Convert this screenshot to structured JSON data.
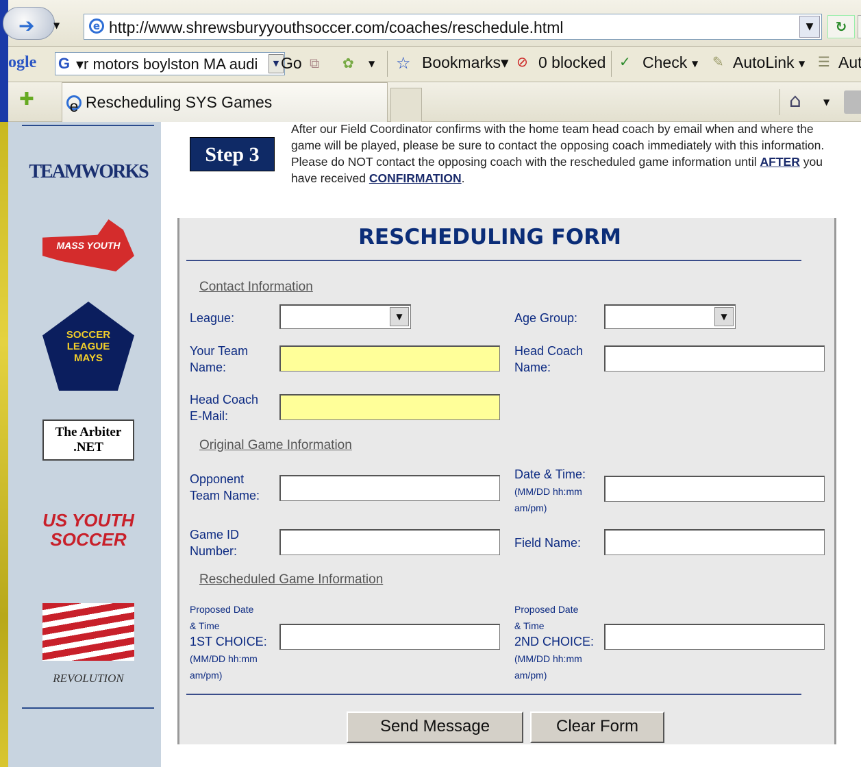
{
  "browser": {
    "address_url": "http://www.shrewsburyyouthsoccer.com/coaches/reschedule.html",
    "google_label": "ogle",
    "search_text": "▾r motors boylston MA audi",
    "go_label": "Go",
    "bookmarks_label": "Bookmarks▾",
    "blocked_label": "0 blocked",
    "check_label": "Check",
    "autolink_label": "AutoLink",
    "autofill_label": "Aut",
    "tab_title": "Rescheduling SYS Games"
  },
  "sidebar": {
    "logos": [
      "TEAMWORKS",
      "MASS YOUTH",
      "SOCCER LEAGUE MAYS",
      "The Arbiter .NET",
      "US YOUTH SOCCER",
      "REVOLUTION"
    ]
  },
  "step": {
    "label": "Step 3",
    "text_1": "After our Field Coordinator confirms with the home team head coach by email when and where the game will be played, please be sure to contact the opposing coach immediately with this information. Please do NOT contact the opposing coach with the rescheduled game information until ",
    "after": "AFTER",
    "text_2": " you have received ",
    "confirmation": "CONFIRMATION",
    "text_3": "."
  },
  "form": {
    "title": "RESCHEDULING FORM",
    "contact_section": "Contact Information",
    "league_label": "League:",
    "age_group_label": "Age Group:",
    "team_name_label_1": "Your Team",
    "team_name_label_2": "Name:",
    "head_coach_label_1": "Head Coach",
    "head_coach_label_2": "Name:",
    "email_label_1": "Head Coach",
    "email_label_2": "E-Mail:",
    "original_section": "Original Game Information",
    "opponent_label_1": "Opponent",
    "opponent_label_2": "Team Name:",
    "datetime_label": "Date & Time:",
    "datetime_hint_1": "(MM/DD hh:mm",
    "datetime_hint_2": "am/pm)",
    "gameid_label_1": "Game ID",
    "gameid_label_2": "Number:",
    "field_label": "Field Name:",
    "rescheduled_section": "Rescheduled Game Information",
    "proposed_1": "Proposed Date",
    "proposed_2": "& Time",
    "choice1": "1ST CHOICE:",
    "choice2": "2ND CHOICE:",
    "hint_1": "(MM/DD hh:mm",
    "hint_2": "am/pm)",
    "send_label": "Send Message",
    "clear_label": "Clear Form"
  }
}
